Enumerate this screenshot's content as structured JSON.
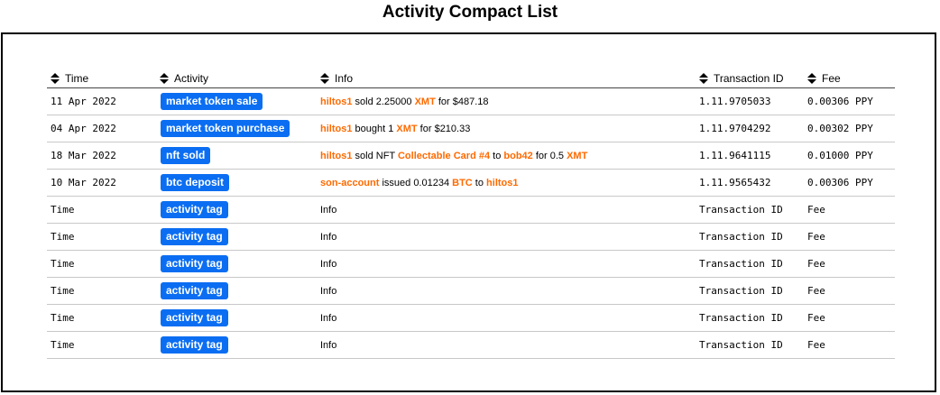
{
  "page": {
    "title": "Activity Compact List"
  },
  "columns": {
    "time": "Time",
    "activity": "Activity",
    "info": "Info",
    "transaction_id": "Transaction ID",
    "fee": "Fee"
  },
  "colors": {
    "tag_background": "#0b6ef2",
    "highlight": "#ff6a00"
  },
  "rows": [
    {
      "time": "11 Apr 2022",
      "activity": "market token sale",
      "info": [
        {
          "text": "hiltos1",
          "highlight": true
        },
        {
          "text": " sold 2.25000 ",
          "highlight": false
        },
        {
          "text": "XMT",
          "highlight": true
        },
        {
          "text": " for $487.18",
          "highlight": false
        }
      ],
      "transaction_id": "1.11.9705033",
      "fee": "0.00306 PPY"
    },
    {
      "time": "04 Apr 2022",
      "activity": "market token purchase",
      "info": [
        {
          "text": "hiltos1",
          "highlight": true
        },
        {
          "text": " bought 1 ",
          "highlight": false
        },
        {
          "text": "XMT",
          "highlight": true
        },
        {
          "text": " for $210.33",
          "highlight": false
        }
      ],
      "transaction_id": "1.11.9704292",
      "fee": "0.00302 PPY"
    },
    {
      "time": "18 Mar 2022",
      "activity": "nft sold",
      "info": [
        {
          "text": "hiltos1",
          "highlight": true
        },
        {
          "text": " sold NFT ",
          "highlight": false
        },
        {
          "text": "Collectable Card #4",
          "highlight": true
        },
        {
          "text": " to ",
          "highlight": false
        },
        {
          "text": "bob42",
          "highlight": true
        },
        {
          "text": " for 0.5 ",
          "highlight": false
        },
        {
          "text": "XMT",
          "highlight": true
        }
      ],
      "transaction_id": "1.11.9641115",
      "fee": "0.01000 PPY"
    },
    {
      "time": "10 Mar 2022",
      "activity": "btc deposit",
      "info": [
        {
          "text": "son-account",
          "highlight": true
        },
        {
          "text": " issued 0.01234 ",
          "highlight": false
        },
        {
          "text": "BTC",
          "highlight": true
        },
        {
          "text": " to ",
          "highlight": false
        },
        {
          "text": "hiltos1",
          "highlight": true
        }
      ],
      "transaction_id": "1.11.9565432",
      "fee": "0.00306 PPY"
    },
    {
      "time": "Time",
      "activity": "activity tag",
      "info": [
        {
          "text": "Info",
          "highlight": false
        }
      ],
      "transaction_id": "Transaction ID",
      "fee": "Fee"
    },
    {
      "time": "Time",
      "activity": "activity tag",
      "info": [
        {
          "text": "Info",
          "highlight": false
        }
      ],
      "transaction_id": "Transaction ID",
      "fee": "Fee"
    },
    {
      "time": "Time",
      "activity": "activity tag",
      "info": [
        {
          "text": "Info",
          "highlight": false
        }
      ],
      "transaction_id": "Transaction ID",
      "fee": "Fee"
    },
    {
      "time": "Time",
      "activity": "activity tag",
      "info": [
        {
          "text": "Info",
          "highlight": false
        }
      ],
      "transaction_id": "Transaction ID",
      "fee": "Fee"
    },
    {
      "time": "Time",
      "activity": "activity tag",
      "info": [
        {
          "text": "Info",
          "highlight": false
        }
      ],
      "transaction_id": "Transaction ID",
      "fee": "Fee"
    },
    {
      "time": "Time",
      "activity": "activity tag",
      "info": [
        {
          "text": "Info",
          "highlight": false
        }
      ],
      "transaction_id": "Transaction ID",
      "fee": "Fee"
    }
  ]
}
